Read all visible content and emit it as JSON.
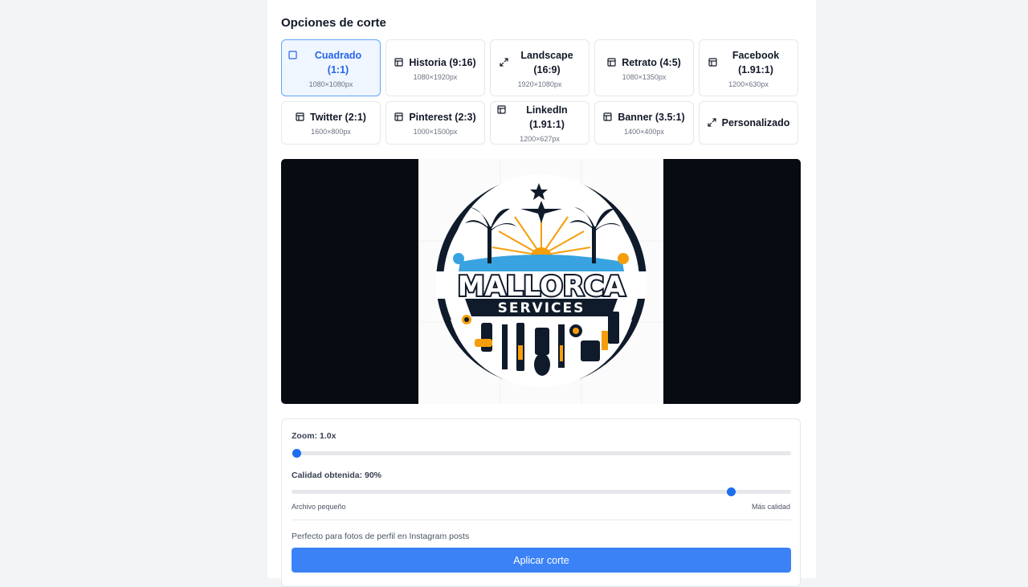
{
  "section_title": "Opciones de corte",
  "crop_options": [
    {
      "label": "Cuadrado (1:1)",
      "dims": "1080×1080px",
      "icon": "square-icon",
      "active": true
    },
    {
      "label": "Historia (9:16)",
      "dims": "1080×1920px",
      "icon": "layout-icon"
    },
    {
      "label": "Landscape (16:9)",
      "dims": "1920×1080px",
      "icon": "expand-icon"
    },
    {
      "label": "Retrato (4:5)",
      "dims": "1080×1350px",
      "icon": "layout-icon"
    },
    {
      "label": "Facebook (1.91:1)",
      "dims": "1200×630px",
      "icon": "layout-icon"
    },
    {
      "label": "Twitter (2:1)",
      "dims": "1600×800px",
      "icon": "layout-icon"
    },
    {
      "label": "Pinterest (2:3)",
      "dims": "1000×1500px",
      "icon": "layout-icon"
    },
    {
      "label": "LinkedIn (1.91:1)",
      "dims": "1200×627px",
      "icon": "layout-icon"
    },
    {
      "label": "Banner (3.5:1)",
      "dims": "1400×400px",
      "icon": "layout-icon"
    },
    {
      "label": "Personalizado",
      "dims": "",
      "icon": "expand-icon"
    }
  ],
  "preview": {
    "logo_text": "MALLORCA",
    "logo_subtext": "SERVICES"
  },
  "controls": {
    "zoom_label": "Zoom: 1.0x",
    "zoom_value": 0,
    "quality_label": "Calidad obtenida: 90%",
    "quality_value": 0.88,
    "quality_min_label": "Archivo pequeño",
    "quality_max_label": "Más calidad",
    "hint": "Perfecto para fotos de perfil en Instagram posts",
    "apply_label": "Aplicar corte"
  },
  "colors": {
    "accent": "#3b82f6",
    "active_bg": "#eff6ff",
    "active_text": "#2563eb",
    "preview_bg": "#070b12"
  }
}
